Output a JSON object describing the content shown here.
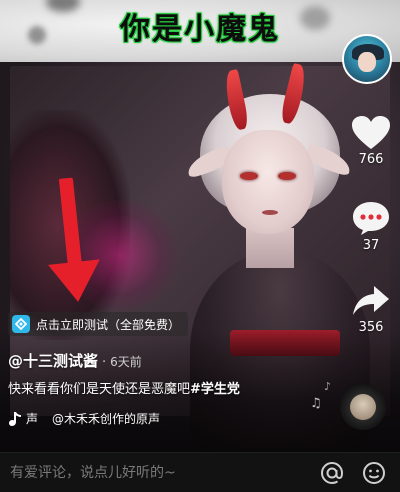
{
  "banner": {
    "title": "你是小魔鬼"
  },
  "sidebar": {
    "likes": "766",
    "comments": "37",
    "shares": "356"
  },
  "link_chip": {
    "label": "点击立即测试（全部免费）"
  },
  "post": {
    "author": "@十三测试酱",
    "separator": "·",
    "time": "6天前",
    "caption_text": "快来看看你们是天使还是恶魔吧",
    "caption_tag": "#学生党"
  },
  "music": {
    "prefix": "声",
    "title": "@木禾禾创作的原声"
  },
  "comment_bar": {
    "placeholder": "有爱评论，说点儿好听的~"
  },
  "colors": {
    "title_glow": "#24c83c",
    "arrow": "#e5202a",
    "link_icon": "#2fb8e8"
  }
}
